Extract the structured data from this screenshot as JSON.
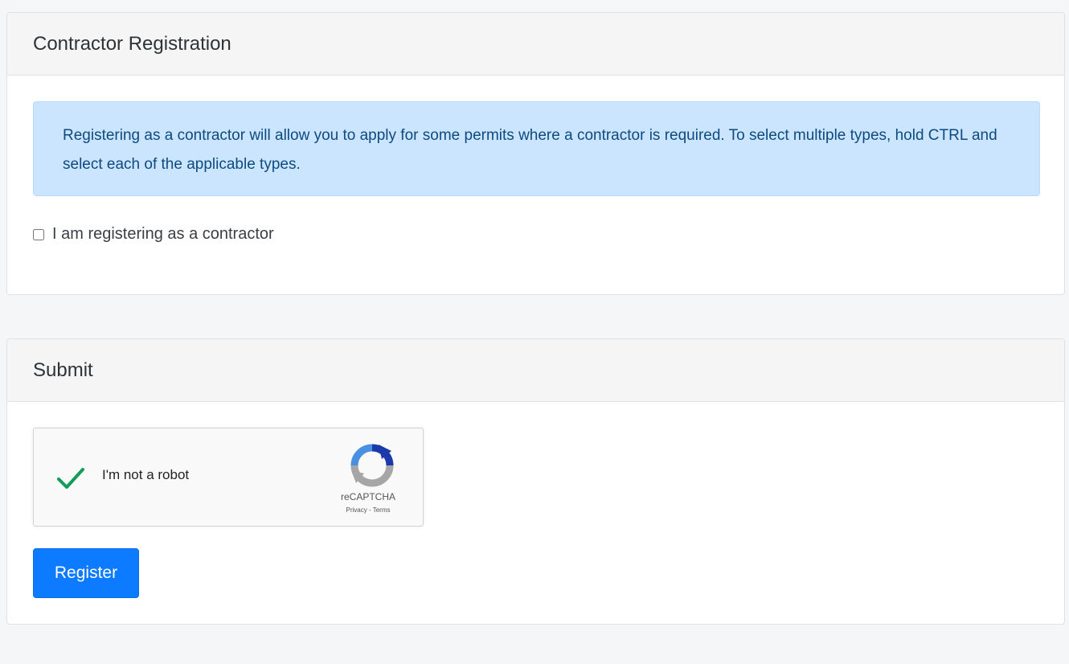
{
  "contractor_section": {
    "title": "Contractor Registration",
    "info_text": "Registering as a contractor will allow you to apply for some permits where a contractor is required. To select multiple types, hold CTRL and select each of the applicable types.",
    "checkbox_label": "I am registering as a contractor",
    "checkbox_checked": false
  },
  "submit_section": {
    "title": "Submit",
    "recaptcha": {
      "label": "I'm not a robot",
      "brand": "reCAPTCHA",
      "links": "Privacy - Terms",
      "verified": true
    },
    "register_label": "Register"
  },
  "colors": {
    "accent": "#0d7bff",
    "info_background": "#cce5ff",
    "check_green": "#0f9d58"
  }
}
